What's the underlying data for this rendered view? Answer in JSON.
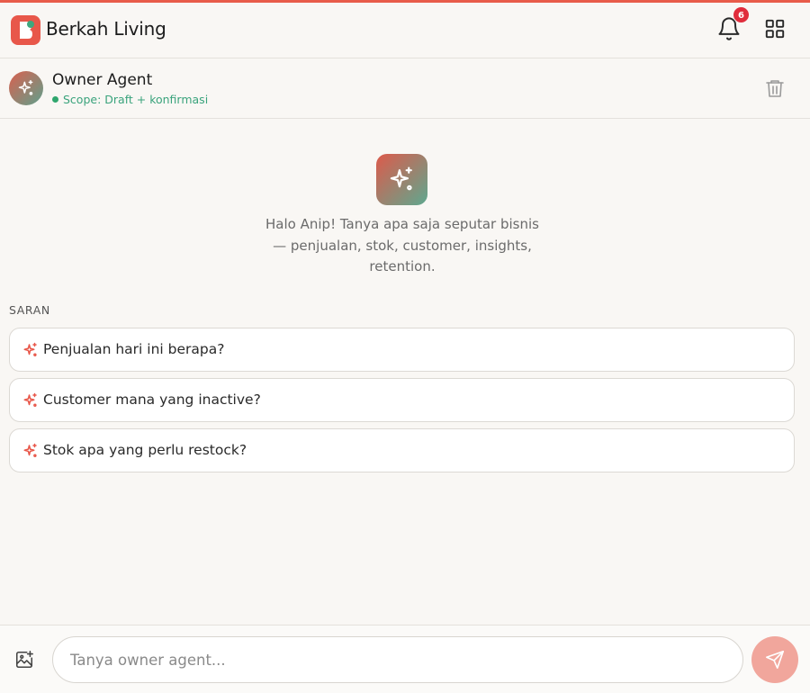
{
  "app": {
    "title": "Berkah Living",
    "notification_count": "6"
  },
  "agent": {
    "name": "Owner Agent",
    "scope": "Scope: Draft + konfirmasi",
    "status_color": "#2fa66d"
  },
  "greeting": {
    "text": "Halo Anip! Tanya apa saja seputar bisnis — penjualan, stok, customer, insights, retention."
  },
  "suggestions": {
    "label": "SARAN",
    "items": [
      {
        "label": "Penjualan hari ini berapa?"
      },
      {
        "label": "Customer mana yang inactive?"
      },
      {
        "label": "Stok apa yang perlu restock?"
      }
    ]
  },
  "composer": {
    "placeholder": "Tanya owner agent..."
  },
  "icons": {
    "logo": "brand-logo-icon",
    "bell": "bell-icon",
    "grid": "grid-icon",
    "trash": "trash-icon",
    "sparkle": "sparkle-icon",
    "image_add": "image-add-icon",
    "send": "send-icon"
  },
  "colors": {
    "accent": "#e8574a",
    "accent_soft": "#f1a69c",
    "badge": "#e02d3c",
    "scope_text": "#3aa37c"
  }
}
